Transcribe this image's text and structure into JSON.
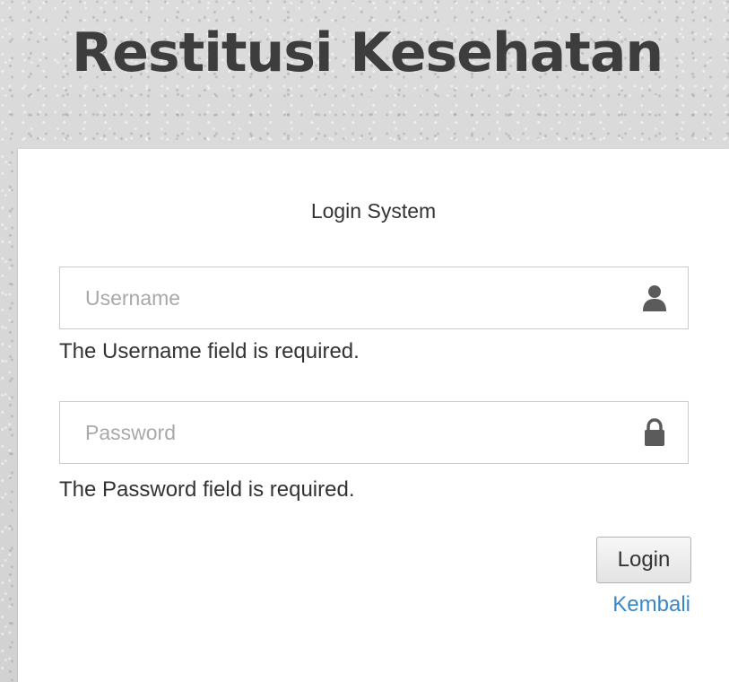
{
  "app": {
    "title": "Restitusi Kesehatan"
  },
  "login": {
    "heading": "Login System",
    "username": {
      "placeholder": "Username",
      "value": "",
      "error": "The Username field is required.",
      "icon": "user-icon"
    },
    "password": {
      "placeholder": "Password",
      "value": "",
      "error": "The Password field is required.",
      "icon": "lock-icon"
    },
    "login_button": "Login",
    "back_link": "Kembali"
  },
  "colors": {
    "title_text": "#3d3d3d",
    "link": "#3a87c8",
    "background": "#d9d9d9",
    "card": "#ffffff"
  }
}
